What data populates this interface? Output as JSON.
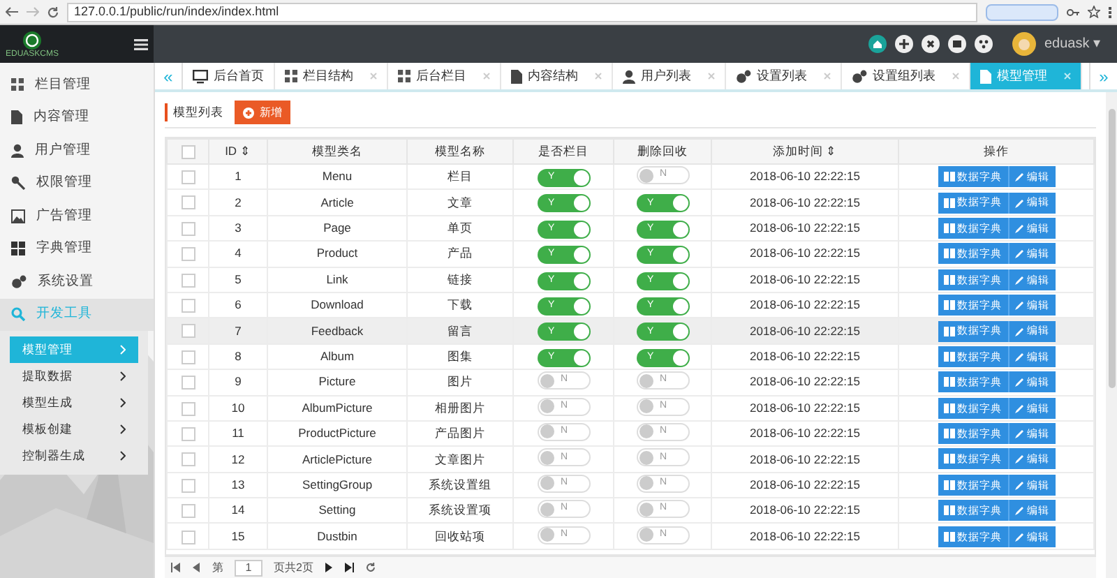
{
  "browser": {
    "url": "127.0.0.1/public/run/index/index.html"
  },
  "header": {
    "logo_text": "EDUASKCMS",
    "user": "eduask",
    "caret": "▾"
  },
  "sidebar": {
    "items": [
      {
        "label": "栏目管理",
        "expanded": false
      },
      {
        "label": "内容管理",
        "expanded": false
      },
      {
        "label": "用户管理",
        "expanded": false
      },
      {
        "label": "权限管理",
        "expanded": false
      },
      {
        "label": "广告管理",
        "expanded": false
      },
      {
        "label": "字典管理",
        "expanded": false
      },
      {
        "label": "系统设置",
        "expanded": false
      },
      {
        "label": "开发工具",
        "expanded": true,
        "children": [
          {
            "label": "模型管理",
            "selected": true
          },
          {
            "label": "提取数据",
            "selected": false
          },
          {
            "label": "模型生成",
            "selected": false
          },
          {
            "label": "模板创建",
            "selected": false
          },
          {
            "label": "控制器生成",
            "selected": false
          }
        ]
      }
    ]
  },
  "tabs": {
    "prev": "«",
    "next": "»",
    "items": [
      {
        "label": "后台首页",
        "closable": false,
        "selected": false
      },
      {
        "label": "栏目结构",
        "closable": true,
        "selected": false
      },
      {
        "label": "后台栏目",
        "closable": true,
        "selected": false
      },
      {
        "label": "内容结构",
        "closable": true,
        "selected": false
      },
      {
        "label": "用户列表",
        "closable": true,
        "selected": false
      },
      {
        "label": "设置列表",
        "closable": true,
        "selected": false
      },
      {
        "label": "设置组列表",
        "closable": true,
        "selected": false
      },
      {
        "label": "模型管理",
        "closable": true,
        "selected": true
      }
    ]
  },
  "toolbar": {
    "title": "模型列表",
    "add_button": "新增"
  },
  "table": {
    "select_all": {
      "checked": false
    },
    "columns": [
      "ID ⇕",
      "模型类名",
      "模型名称",
      "是否栏目",
      "删除回收",
      "添加时间 ⇕",
      "操作"
    ],
    "rows": [
      {
        "checked": false,
        "id": "1",
        "class_name": "Menu",
        "name": "栏目",
        "is_column": {
          "on": true,
          "label": "Y"
        },
        "recycle": {
          "on": false,
          "label": "N"
        },
        "added": "2018-06-10 22:22:15",
        "actions": [
          "数据字典",
          "编辑"
        ],
        "hovered": false
      },
      {
        "checked": false,
        "id": "2",
        "class_name": "Article",
        "name": "文章",
        "is_column": {
          "on": true,
          "label": "Y"
        },
        "recycle": {
          "on": true,
          "label": "Y"
        },
        "added": "2018-06-10 22:22:15",
        "actions": [
          "数据字典",
          "编辑"
        ],
        "hovered": false
      },
      {
        "checked": false,
        "id": "3",
        "class_name": "Page",
        "name": "单页",
        "is_column": {
          "on": true,
          "label": "Y"
        },
        "recycle": {
          "on": true,
          "label": "Y"
        },
        "added": "2018-06-10 22:22:15",
        "actions": [
          "数据字典",
          "编辑"
        ],
        "hovered": false
      },
      {
        "checked": false,
        "id": "4",
        "class_name": "Product",
        "name": "产品",
        "is_column": {
          "on": true,
          "label": "Y"
        },
        "recycle": {
          "on": true,
          "label": "Y"
        },
        "added": "2018-06-10 22:22:15",
        "actions": [
          "数据字典",
          "编辑"
        ],
        "hovered": false
      },
      {
        "checked": false,
        "id": "5",
        "class_name": "Link",
        "name": "链接",
        "is_column": {
          "on": true,
          "label": "Y"
        },
        "recycle": {
          "on": true,
          "label": "Y"
        },
        "added": "2018-06-10 22:22:15",
        "actions": [
          "数据字典",
          "编辑"
        ],
        "hovered": false
      },
      {
        "checked": false,
        "id": "6",
        "class_name": "Download",
        "name": "下载",
        "is_column": {
          "on": true,
          "label": "Y"
        },
        "recycle": {
          "on": true,
          "label": "Y"
        },
        "added": "2018-06-10 22:22:15",
        "actions": [
          "数据字典",
          "编辑"
        ],
        "hovered": false
      },
      {
        "checked": false,
        "id": "7",
        "class_name": "Feedback",
        "name": "留言",
        "is_column": {
          "on": true,
          "label": "Y"
        },
        "recycle": {
          "on": true,
          "label": "Y"
        },
        "added": "2018-06-10 22:22:15",
        "actions": [
          "数据字典",
          "编辑"
        ],
        "hovered": true
      },
      {
        "checked": false,
        "id": "8",
        "class_name": "Album",
        "name": "图集",
        "is_column": {
          "on": true,
          "label": "Y"
        },
        "recycle": {
          "on": true,
          "label": "Y"
        },
        "added": "2018-06-10 22:22:15",
        "actions": [
          "数据字典",
          "编辑"
        ],
        "hovered": false
      },
      {
        "checked": false,
        "id": "9",
        "class_name": "Picture",
        "name": "图片",
        "is_column": {
          "on": false,
          "label": "N"
        },
        "recycle": {
          "on": false,
          "label": "N"
        },
        "added": "2018-06-10 22:22:15",
        "actions": [
          "数据字典",
          "编辑"
        ],
        "hovered": false
      },
      {
        "checked": false,
        "id": "10",
        "class_name": "AlbumPicture",
        "name": "相册图片",
        "is_column": {
          "on": false,
          "label": "N"
        },
        "recycle": {
          "on": false,
          "label": "N"
        },
        "added": "2018-06-10 22:22:15",
        "actions": [
          "数据字典",
          "编辑"
        ],
        "hovered": false
      },
      {
        "checked": false,
        "id": "11",
        "class_name": "ProductPicture",
        "name": "产品图片",
        "is_column": {
          "on": false,
          "label": "N"
        },
        "recycle": {
          "on": false,
          "label": "N"
        },
        "added": "2018-06-10 22:22:15",
        "actions": [
          "数据字典",
          "编辑"
        ],
        "hovered": false
      },
      {
        "checked": false,
        "id": "12",
        "class_name": "ArticlePicture",
        "name": "文章图片",
        "is_column": {
          "on": false,
          "label": "N"
        },
        "recycle": {
          "on": false,
          "label": "N"
        },
        "added": "2018-06-10 22:22:15",
        "actions": [
          "数据字典",
          "编辑"
        ],
        "hovered": false
      },
      {
        "checked": false,
        "id": "13",
        "class_name": "SettingGroup",
        "name": "系统设置组",
        "is_column": {
          "on": false,
          "label": "N"
        },
        "recycle": {
          "on": false,
          "label": "N"
        },
        "added": "2018-06-10 22:22:15",
        "actions": [
          "数据字典",
          "编辑"
        ],
        "hovered": false
      },
      {
        "checked": false,
        "id": "14",
        "class_name": "Setting",
        "name": "系统设置项",
        "is_column": {
          "on": false,
          "label": "N"
        },
        "recycle": {
          "on": false,
          "label": "N"
        },
        "added": "2018-06-10 22:22:15",
        "actions": [
          "数据字典",
          "编辑"
        ],
        "hovered": false
      },
      {
        "checked": false,
        "id": "15",
        "class_name": "Dustbin",
        "name": "回收站项",
        "is_column": {
          "on": false,
          "label": "N"
        },
        "recycle": {
          "on": false,
          "label": "N"
        },
        "added": "2018-06-10 22:22:15",
        "actions": [
          "数据字典",
          "编辑"
        ],
        "hovered": false
      }
    ]
  },
  "pagination": {
    "page_prefix": "第",
    "page": "1",
    "page_suffix": "页共2页"
  }
}
